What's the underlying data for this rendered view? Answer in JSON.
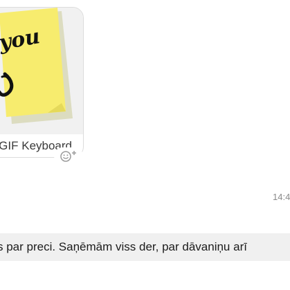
{
  "conversation": {
    "gif_message": {
      "caption": "GIF Keyboard",
      "sticky_note_text": "you",
      "note_color": "#f7ec6e",
      "react_icon": "emoji-add-icon"
    },
    "timestamp": "14:4",
    "text_message": {
      "text": "s par preci. Saņēmām viss der, par dāvaniņu arī"
    }
  }
}
